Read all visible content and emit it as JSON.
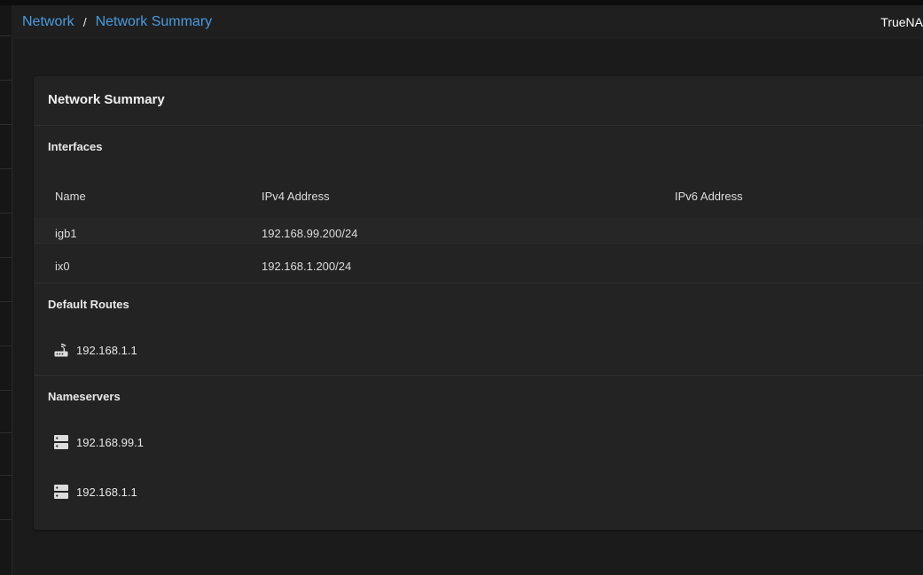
{
  "breadcrumb": {
    "items": [
      {
        "label": "Network"
      },
      {
        "label": "Network Summary"
      }
    ],
    "separator": "/"
  },
  "brand": {
    "text": "TrueNA"
  },
  "card": {
    "title": "Network Summary",
    "interfaces": {
      "title": "Interfaces",
      "columns": [
        "Name",
        "IPv4 Address",
        "IPv6 Address"
      ],
      "rows": [
        {
          "name": "igb1",
          "ipv4": "192.168.99.200/24",
          "ipv6": ""
        },
        {
          "name": "ix0",
          "ipv4": "192.168.1.200/24",
          "ipv6": ""
        }
      ]
    },
    "default_routes": {
      "title": "Default Routes",
      "icon": "router-icon",
      "items": [
        "192.168.1.1"
      ]
    },
    "nameservers": {
      "title": "Nameservers",
      "icon": "dns-server-icon",
      "items": [
        "192.168.99.1",
        "192.168.1.1"
      ]
    }
  },
  "colors": {
    "accent_link": "#4a9be0",
    "background": "#1b1b1b",
    "card": "#232323"
  }
}
